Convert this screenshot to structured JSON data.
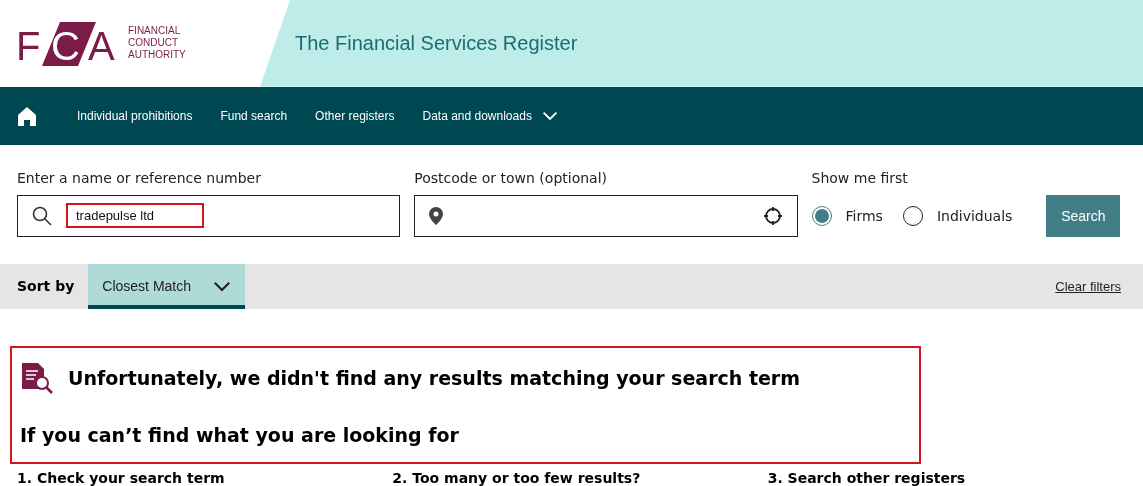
{
  "logo": {
    "letters": [
      "F",
      "C",
      "A"
    ],
    "name_lines": [
      "FINANCIAL",
      "CONDUCT",
      "AUTHORITY"
    ]
  },
  "header": {
    "title": "The Financial Services Register"
  },
  "nav": {
    "items": [
      {
        "label": "Individual prohibitions",
        "kind": "link"
      },
      {
        "label": "Fund search",
        "kind": "link"
      },
      {
        "label": "Other registers",
        "kind": "link"
      },
      {
        "label": "Data and downloads",
        "kind": "dropdown"
      }
    ]
  },
  "search": {
    "name_label": "Enter a name or reference number",
    "name_value": "tradepulse ltd",
    "name_highlighted": true,
    "postcode_label": "Postcode or town (optional)",
    "show_label": "Show me first",
    "options": [
      {
        "label": "Firms",
        "selected": true
      },
      {
        "label": "Individuals",
        "selected": false
      }
    ],
    "button": "Search"
  },
  "sort_bar": {
    "label": "Sort by",
    "value": "Closest Match",
    "clear": "Clear filters"
  },
  "message": {
    "highlighted": true,
    "heading": "Unfortunately, we didn't find any results matching your search term",
    "subheading": "If you can’t find what you are looking for"
  },
  "tips": [
    "1. Check your search term",
    "2. Too many or too few results?",
    "3. Search other registers"
  ]
}
